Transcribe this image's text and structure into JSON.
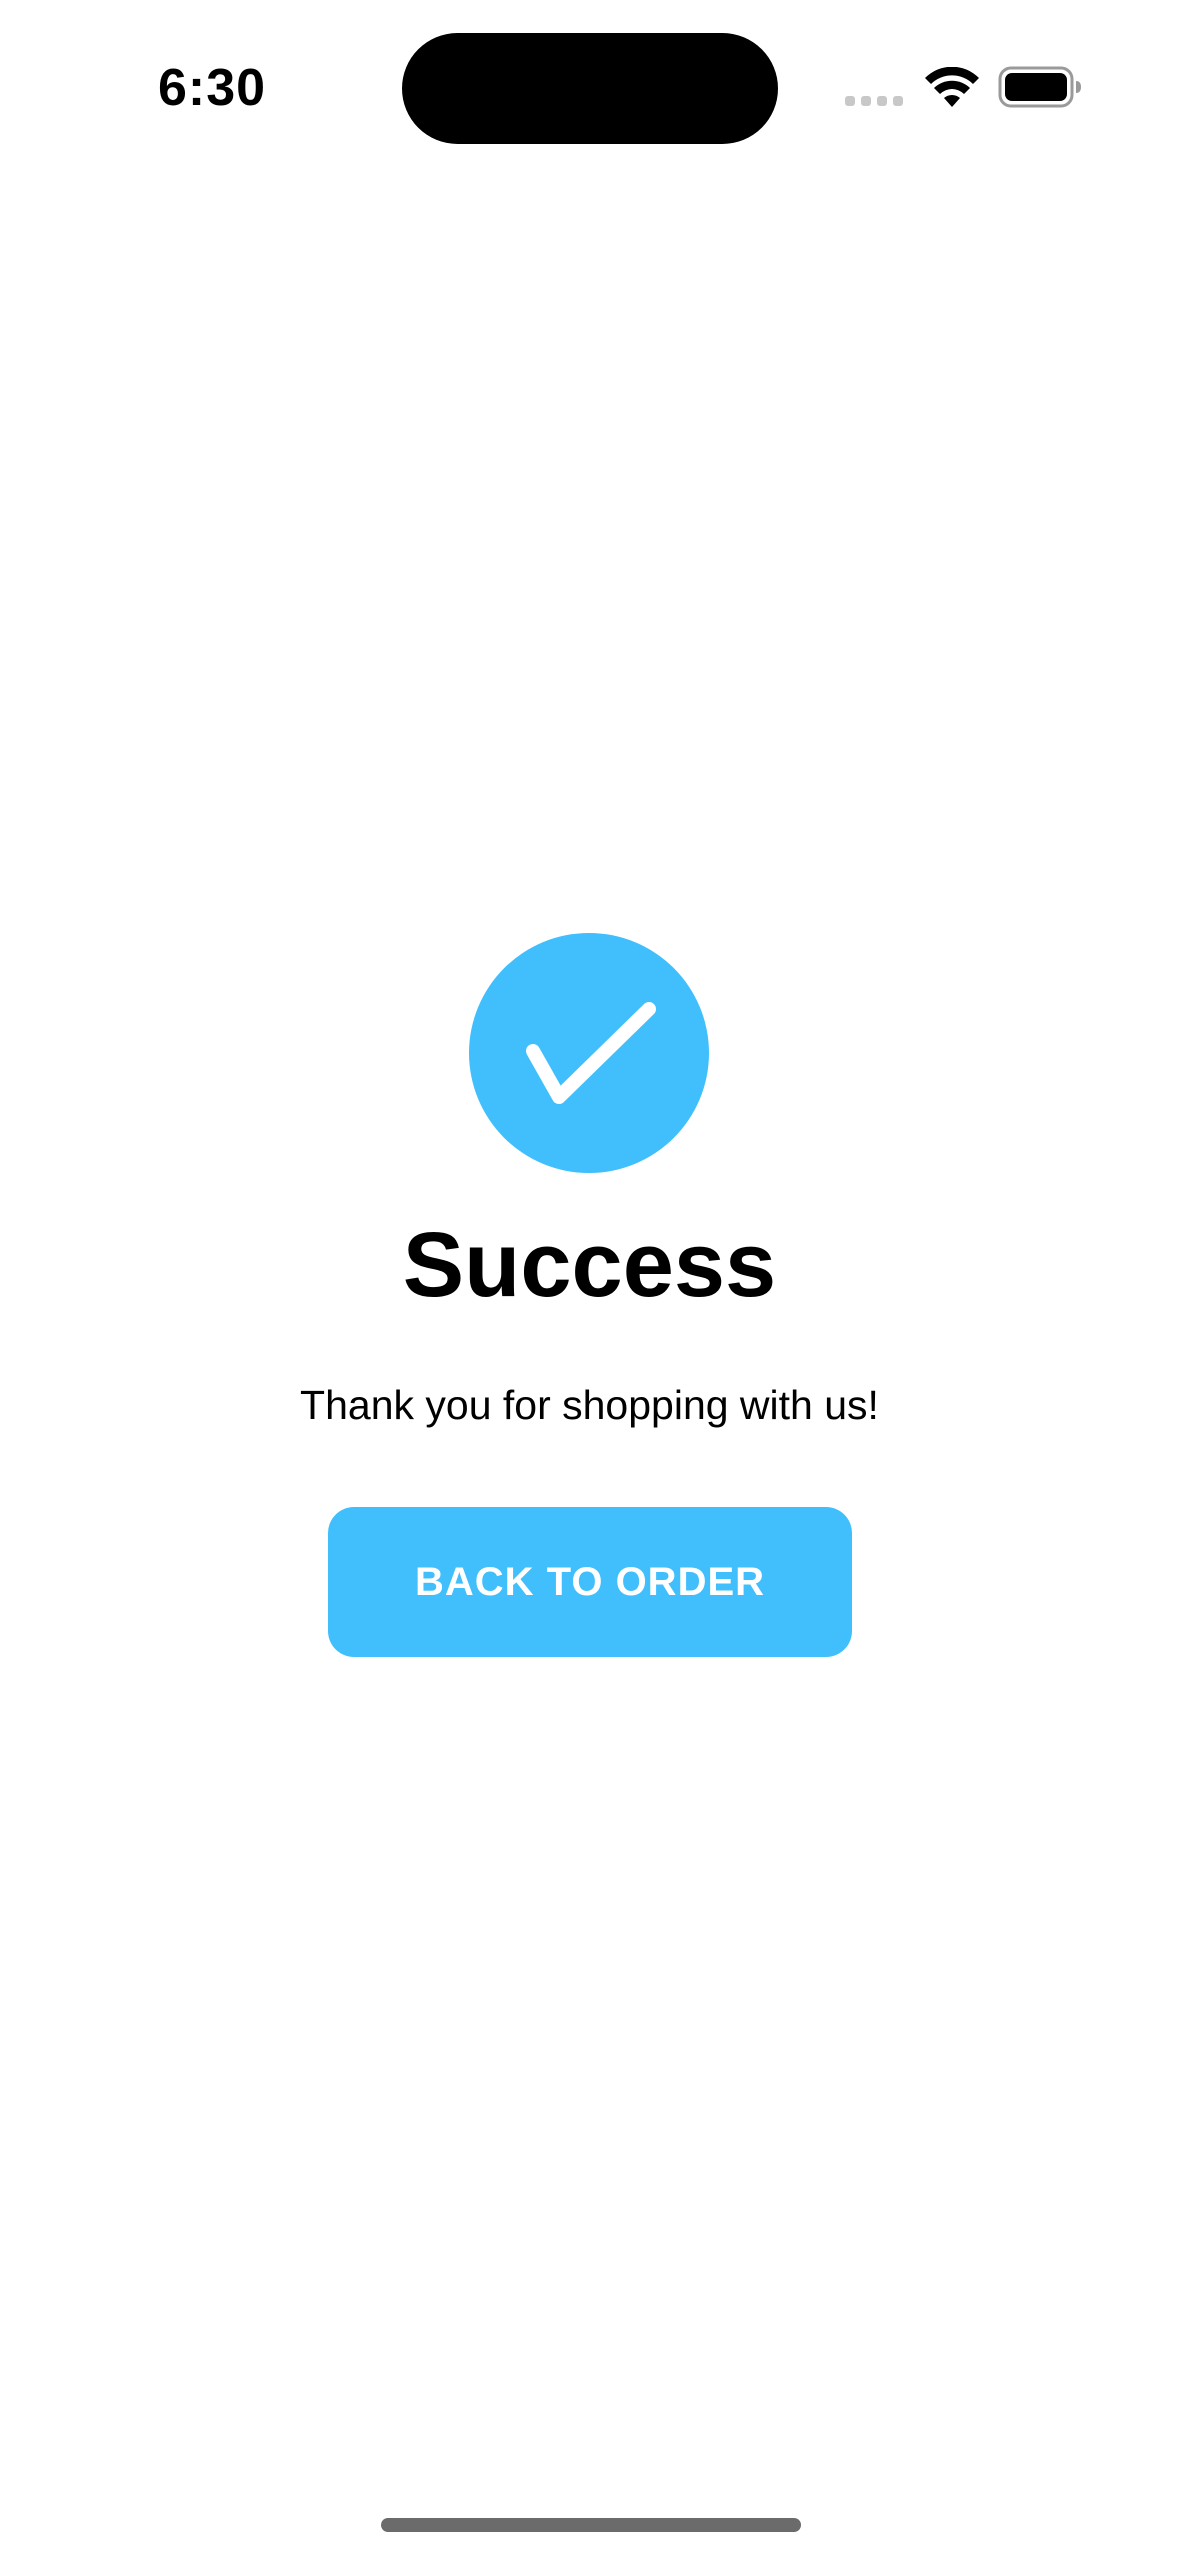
{
  "status_bar": {
    "time": "6:30",
    "icons": [
      "signal-dots-icon",
      "wifi-icon",
      "battery-icon"
    ]
  },
  "success": {
    "icon": "checkmark-circle-icon",
    "title": "Success",
    "message": "Thank you for shopping with us!",
    "button_label": "BACK TO ORDER"
  },
  "colors": {
    "accent": "#40bffc",
    "text": "#000000",
    "background": "#ffffff"
  }
}
